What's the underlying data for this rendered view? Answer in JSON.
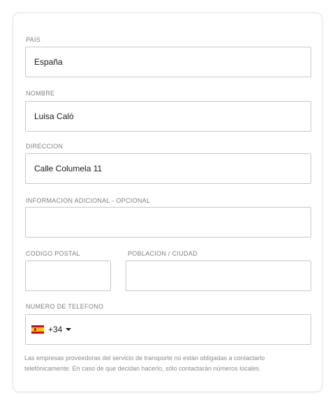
{
  "form": {
    "country": {
      "label": "PAIS",
      "value": "España"
    },
    "name": {
      "label": "NOMBRE",
      "value": "Luisa Caló"
    },
    "address": {
      "label": "DIRECCION",
      "value": "Calle Columela 11"
    },
    "additional_info": {
      "label": "INFORMACION ADICIONAL - OPCIONAL",
      "value": ""
    },
    "postal_code": {
      "label": "CODIGO POSTAL",
      "value": ""
    },
    "city": {
      "label": "POBLACION / CIUDAD",
      "value": ""
    },
    "phone": {
      "label": "NUMERO DE TELEFONO",
      "country_icon": "spain-flag-icon",
      "prefix": "+34",
      "value": ""
    },
    "note": "Las empresas proveedoras del servicio de transporte no están obligadas a contactarlo telefónicamente. En caso de que decidan hacerlo, sólo contactarán números locales."
  }
}
